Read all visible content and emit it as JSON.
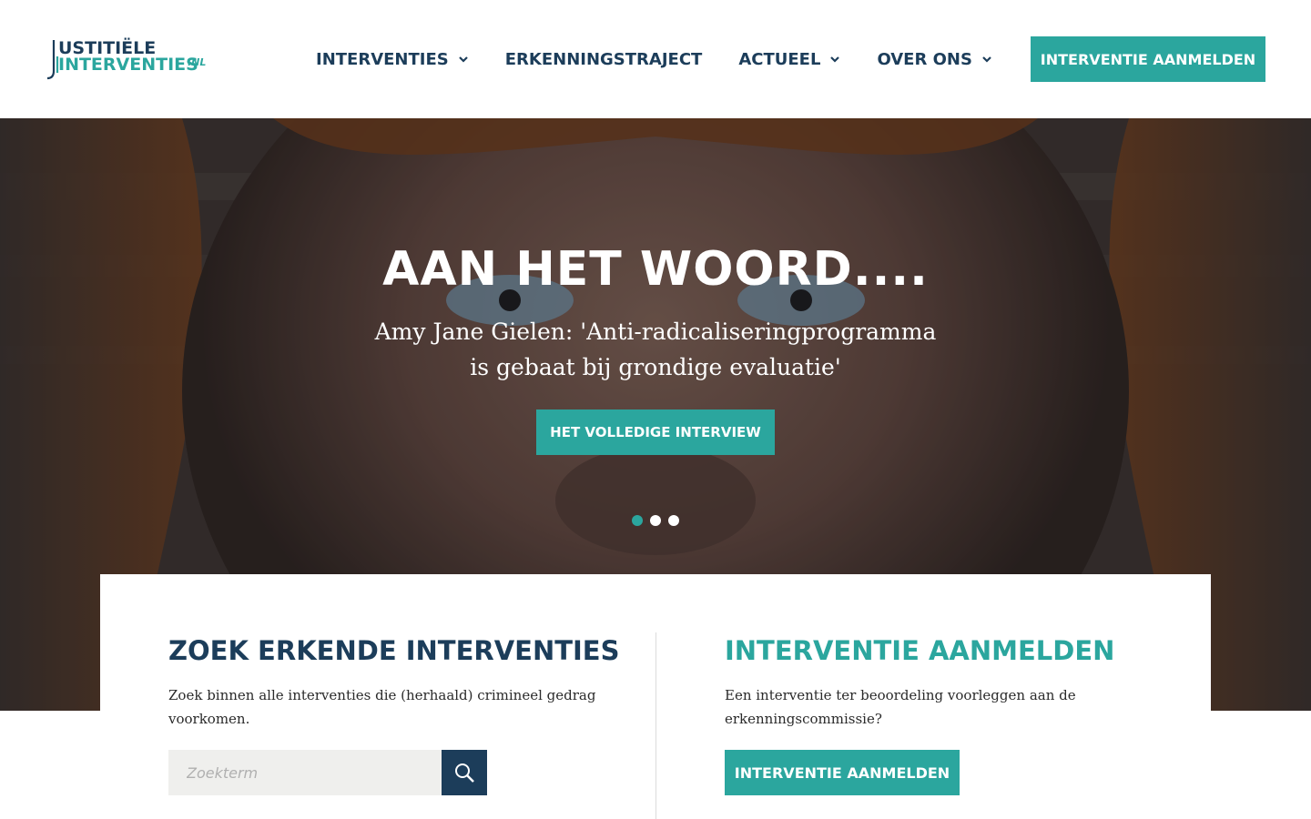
{
  "colors": {
    "brand_dark": "#1c3d5a",
    "brand_teal": "#2ba69e"
  },
  "logo": {
    "line1": "USTITIËLE",
    "line2": "INTERVENTIES",
    "suffix": ".NL"
  },
  "nav": {
    "items": [
      {
        "label": "INTERVENTIES",
        "has_dropdown": true,
        "icon": "chevron-down-icon"
      },
      {
        "label": "ERKENNINGSTRAJECT",
        "has_dropdown": false
      },
      {
        "label": "ACTUEEL",
        "has_dropdown": true,
        "icon": "chevron-down-icon"
      },
      {
        "label": "OVER ONS",
        "has_dropdown": true,
        "icon": "chevron-down-icon"
      }
    ],
    "cta_label": "INTERVENTIE AANMELDEN"
  },
  "hero": {
    "title": "AAN HET WOORD....",
    "subtitle": "Amy Jane Gielen: 'Anti-radicaliseringprogramma is gebaat bij grondige evaluatie'",
    "button_label": "HET VOLLEDIGE INTERVIEW",
    "slides_total": 3,
    "active_slide": 1
  },
  "search_section": {
    "title": "ZOEK ERKENDE INTERVENTIES",
    "text": "Zoek binnen alle interventies die (herhaald) crimineel gedrag voorkomen.",
    "placeholder": "Zoekterm",
    "value": "",
    "button_icon": "search-icon"
  },
  "register_section": {
    "title": "INTERVENTIE AANMELDEN",
    "text": "Een interventie ter beoordeling voorleggen aan de erkenningscommissie?",
    "button_label": "INTERVENTIE AANMELDEN"
  }
}
